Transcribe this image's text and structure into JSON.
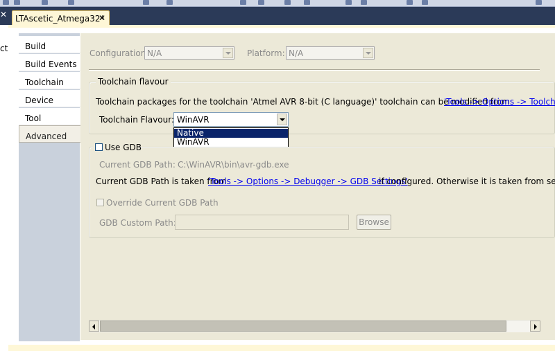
{
  "document_tab": {
    "title": "LTAscetic_Atmega32*",
    "close_glyph": "✕"
  },
  "left_panel": {
    "close_glyph": "✕",
    "partial_text": "ct)"
  },
  "nav": {
    "items": [
      {
        "label": "Build"
      },
      {
        "label": "Build Events"
      },
      {
        "label": "Toolchain"
      },
      {
        "label": "Device"
      },
      {
        "label": "Tool"
      },
      {
        "label": "Advanced"
      }
    ],
    "selected": "Advanced"
  },
  "config": {
    "configuration_label": "Configuration:",
    "configuration_value": "N/A",
    "platform_label": "Platform:",
    "platform_value": "N/A"
  },
  "toolchain": {
    "group_title": "Toolchain flavour",
    "description": "Toolchain packages for the toolchain 'Atmel AVR 8-bit (C language)' toolchain can be modified from",
    "description_link": "'Tools -> Options -> Toolch",
    "flavour_label": "Toolchain Flavour:",
    "flavour_value": "WinAVR",
    "dropdown_options": [
      "Native",
      "WinAVR"
    ],
    "highlighted_option": "Native"
  },
  "gdb": {
    "use_gdb_label": "Use GDB",
    "current_path_label": "Current GDB Path:",
    "current_path_value": "C:\\WinAVR\\bin\\avr-gdb.exe",
    "info_prefix": "Current GDB Path is taken from",
    "info_link": "'Tools -> Options -> Debugger -> GDB Settings'",
    "info_suffix": "if configured. Otherwise it is taken from select",
    "override_label": "Override Current GDB Path",
    "custom_path_label": "GDB Custom Path:",
    "custom_path_value": "",
    "browse_label": "Browse"
  },
  "icons": [
    "close-icon",
    "chevron-down-icon",
    "scroll-left-icon",
    "scroll-right-icon",
    "checkbox"
  ]
}
